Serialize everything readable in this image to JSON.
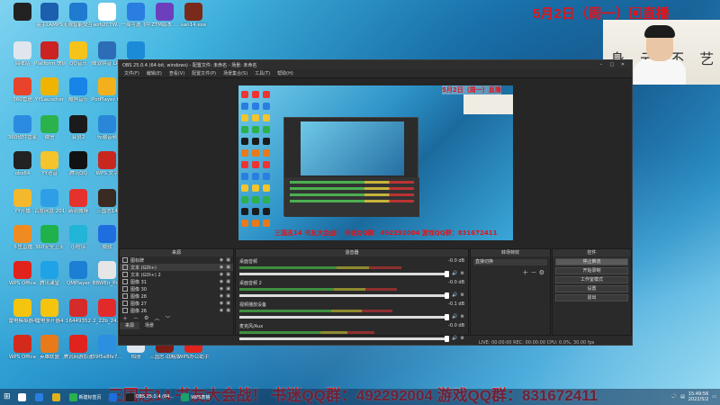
{
  "banner": {
    "date": "5月2日",
    "weekday": "（周一）",
    "live": "直播"
  },
  "camera": {
    "calligraphy": "身 云 不 艺"
  },
  "desktop_icons": [
    {
      "label": "",
      "color": "#222"
    },
    {
      "label": "易手LAMPS",
      "color": "#1b5fae"
    },
    {
      "label": "无限智能交互 wTAC...",
      "color": "#1f7ad0"
    },
    {
      "label": "wzh2CTW...",
      "color": "#ffffff"
    },
    {
      "label": "一周可选飞中",
      "color": "#2a7de1"
    },
    {
      "label": "ZTM版本 ...",
      "color": "#6d3fbd"
    },
    {
      "label": "san14.exe",
      "color": "#7a2a1a"
    },
    {
      "label": "回收站",
      "color": "#dfe6ee"
    },
    {
      "label": "Platform 快捷方式",
      "color": "#c22"
    },
    {
      "label": "QQ音乐",
      "color": "#f6c31a"
    },
    {
      "label": "微软拼音 LPRO 电话",
      "color": "#2d6db7"
    },
    {
      "label": "分享",
      "color": "#1b8bd8"
    },
    {
      "label": "360管理",
      "color": "#e9432b"
    },
    {
      "label": "YYLauncher",
      "color": "#f0b400"
    },
    {
      "label": "酷狗音乐",
      "color": "#1784e8"
    },
    {
      "label": "PotPlayer 64 bit",
      "color": "#f2b01d"
    },
    {
      "label": "360软件管家",
      "color": "#2b8be0"
    },
    {
      "label": "微信",
      "color": "#2bb24c"
    },
    {
      "label": "会员2",
      "color": "#1b1b1b"
    },
    {
      "label": "传输音频",
      "color": "#2a87d8"
    },
    {
      "label": "obs64",
      "color": "#222"
    },
    {
      "label": "YY语音",
      "color": "#f3c42b"
    },
    {
      "label": "腾讯QQ",
      "color": "#111"
    },
    {
      "label": "WPS 文字",
      "color": "#c8271e"
    },
    {
      "label": "YY开播",
      "color": "#f3b82b"
    },
    {
      "label": "百度网盘 2019.1.2",
      "color": "#2e9ee6"
    },
    {
      "label": "新浪微博",
      "color": "#e6322c"
    },
    {
      "label": "三国志14",
      "color": "#3a2a22"
    },
    {
      "label": "斗鱼直播",
      "color": "#f08b21"
    },
    {
      "label": "360安全卫士",
      "color": "#1fb14a"
    },
    {
      "label": "小程序",
      "color": "#21b5d8"
    },
    {
      "label": "微软",
      "color": "#1f6ee0"
    },
    {
      "label": "WPS Office",
      "color": "#e1231b"
    },
    {
      "label": "腾讯课堂",
      "color": "#1fa3e6"
    },
    {
      "label": "QMPlayer",
      "color": "#1c7fd4"
    },
    {
      "label": "BBWEn_Pr...",
      "color": "#e6e6e6"
    },
    {
      "label": "雷电模拟器4",
      "color": "#f5c40f"
    },
    {
      "label": "雷电多开器4",
      "color": "#f5c40f"
    },
    {
      "label": "16449352",
      "color": "#d62b2b"
    },
    {
      "label": "2_22b_24...",
      "color": "#e32a2a"
    },
    {
      "label": "WPS Office",
      "color": "#d42a1b"
    },
    {
      "label": "英雄联盟",
      "color": "#e87a1a"
    },
    {
      "label": "腾讯网游加速",
      "color": "#e0241d"
    },
    {
      "label": "39f5e8fe7...",
      "color": "#2d8fe0"
    },
    {
      "label": "相册",
      "color": "#dfe6ee"
    },
    {
      "label": "三国志·战略版",
      "color": "#7a1d18"
    },
    {
      "label": "WPS办公助手",
      "color": "#e1231b"
    }
  ],
  "obs": {
    "title": "OBS 25.0.4 (64-bit, windows) - 配置文件: 未命名 - 场景: 未命名",
    "menu": [
      "文件(F)",
      "编辑(E)",
      "查看(V)",
      "配置文件(P)",
      "场景集合(S)",
      "工具(T)",
      "帮助(H)"
    ],
    "preview": {
      "banner": "5月2日（周一）直播",
      "caption": "三国志14  书友大会战！  书迷QQ群：492292004    游戏QQ群：831672411"
    },
    "sources_title": "来源",
    "sources": [
      {
        "name": "图标牌",
        "selected": false
      },
      {
        "name": "文本 (GDI+)",
        "selected": true
      },
      {
        "name": "文本 (GDI+) 2",
        "selected": false
      },
      {
        "name": "图像 31",
        "selected": false
      },
      {
        "name": "图像 30",
        "selected": false
      },
      {
        "name": "图像 28",
        "selected": false
      },
      {
        "name": "图像 27",
        "selected": false
      },
      {
        "name": "图像 26",
        "selected": false
      }
    ],
    "tabs": [
      "来源",
      "场景"
    ],
    "mixer_title": "混音器",
    "mixer": [
      {
        "name": "桌面音频",
        "db": "-0.0 dB",
        "level": 0.72
      },
      {
        "name": "桌面音频 2",
        "db": "-0.0 dB",
        "level": 0.7
      },
      {
        "name": "视频播放设备",
        "db": "-0.1 dB",
        "level": 0.68
      },
      {
        "name": "麦克风/Aux",
        "db": "-0.0 dB",
        "level": 0.6
      }
    ],
    "transitions_title": "转场特效",
    "transition_value": "直接切换",
    "controls_title": "控件",
    "controls": [
      {
        "label": "停止推流",
        "active": true
      },
      {
        "label": "开始录制",
        "active": false
      },
      {
        "label": "工作室模式",
        "active": false
      },
      {
        "label": "设置",
        "active": false
      },
      {
        "label": "退出",
        "active": false
      }
    ],
    "status": "LIVE: 00:00:00    REC: 00:00:00    CPU: 0.0%, 30.00 fps"
  },
  "caption": "三国志14  书友大会战！  书迷QQ群：492292004    游戏QQ群：831672411",
  "taskbar": {
    "apps": [
      {
        "label": "",
        "color": "#ffffff"
      },
      {
        "label": "",
        "color": "#2a7de1"
      },
      {
        "label": "",
        "color": "#e0b21a"
      },
      {
        "label": "新建标签页",
        "color": "#2bb24c"
      },
      {
        "label": "",
        "color": "#1f6ee0"
      },
      {
        "label": "OBS 25.0.4 (64...",
        "color": "#222222"
      },
      {
        "label": "WPS表格",
        "color": "#1aa06b"
      }
    ],
    "time": "15:49:56",
    "date": "2022/5/2"
  }
}
